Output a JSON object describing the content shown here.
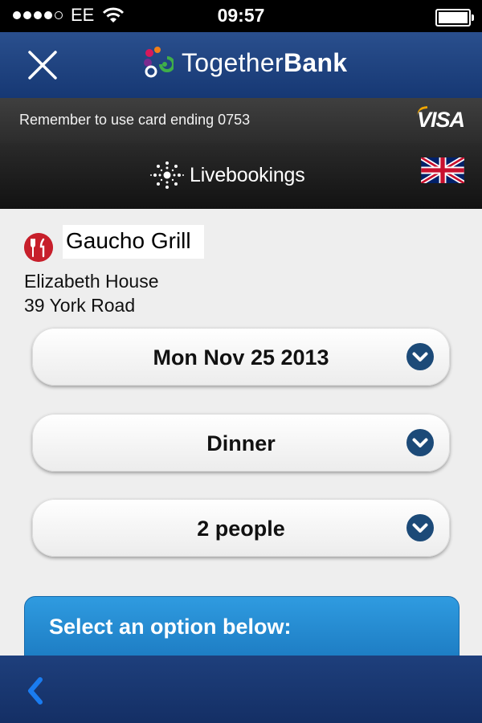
{
  "status_bar": {
    "carrier": "EE",
    "time": "09:57",
    "signal_dots_filled": 4,
    "signal_dots_total": 5,
    "icons": [
      "wifi-icon",
      "battery-icon"
    ]
  },
  "header": {
    "brand_prefix": "Together",
    "brand_suffix": "Bank",
    "icons": [
      "close-icon",
      "togetherbank-logo-icon"
    ]
  },
  "card_notice": {
    "text": "Remember to use card ending 0753",
    "card_brand": "VISA"
  },
  "partner_bar": {
    "name": "Livebookings",
    "icons": [
      "livebookings-logo-icon",
      "uk-flag-icon"
    ]
  },
  "restaurant": {
    "name": "Gaucho Grill",
    "address_line1": "Elizabeth House",
    "address_line2": "39 York Road",
    "icon": "restaurant-cutlery-icon"
  },
  "selectors": {
    "date": "Mon Nov 25 2013",
    "meal": "Dinner",
    "party_size": "2 people"
  },
  "options_panel": {
    "title": "Select an option below:"
  },
  "bottom_bar": {
    "icons": [
      "back-chevron-icon"
    ]
  },
  "colors": {
    "header_blue": "#1f4480",
    "accent_blue": "#1a77be",
    "chevron_navy": "#1c4a78",
    "restaurant_red": "#c71f2b"
  }
}
